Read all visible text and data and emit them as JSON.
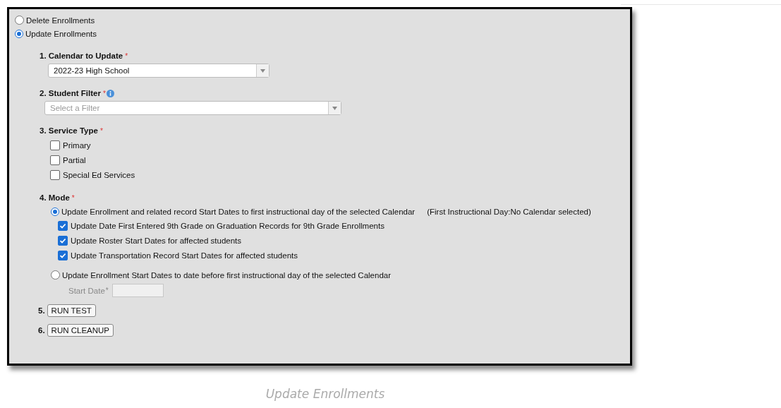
{
  "top_options": [
    {
      "label": "Delete Enrollments",
      "selected": false
    },
    {
      "label": "Update Enrollments",
      "selected": true
    }
  ],
  "sections": [
    {
      "kind": "select",
      "label": "1. Calendar to Update",
      "required_mark": "*",
      "value": "2022-23 High School"
    },
    {
      "kind": "select",
      "label": "2. Student Filter",
      "required_mark": "*",
      "info": true,
      "placeholder": "Select a Filter"
    },
    {
      "kind": "checkboxes",
      "label": "3. Service Type",
      "required_mark": "*",
      "options": [
        {
          "label": "Primary",
          "checked": false
        },
        {
          "label": "Partial",
          "checked": false
        },
        {
          "label": "Special Ed Services",
          "checked": false
        }
      ]
    },
    {
      "kind": "mode",
      "label": "4. Mode",
      "required_mark": "*",
      "modes": [
        {
          "label": "Update Enrollment and related record Start Dates to first instructional day of the selected Calendar",
          "note": "(First Instructional Day:No Calendar selected)",
          "selected": true,
          "options": [
            {
              "label": "Update Date First Entered 9th Grade on Graduation Records for 9th Grade Enrollments",
              "checked": true
            },
            {
              "label": "Update Roster Start Dates for affected students",
              "checked": true
            },
            {
              "label": "Update Transportation Record Start Dates for affected students",
              "checked": true
            }
          ]
        },
        {
          "label": "Update Enrollment Start Dates to date before first instructional day of the selected Calendar",
          "selected": false,
          "field_label": "Start Date",
          "field_required_mark": "*"
        }
      ]
    },
    {
      "kind": "button",
      "number": "5.",
      "button": "RUN TEST"
    },
    {
      "kind": "button",
      "number": "6.",
      "button": "RUN CLEANUP"
    }
  ],
  "caption": "Update Enrollments"
}
